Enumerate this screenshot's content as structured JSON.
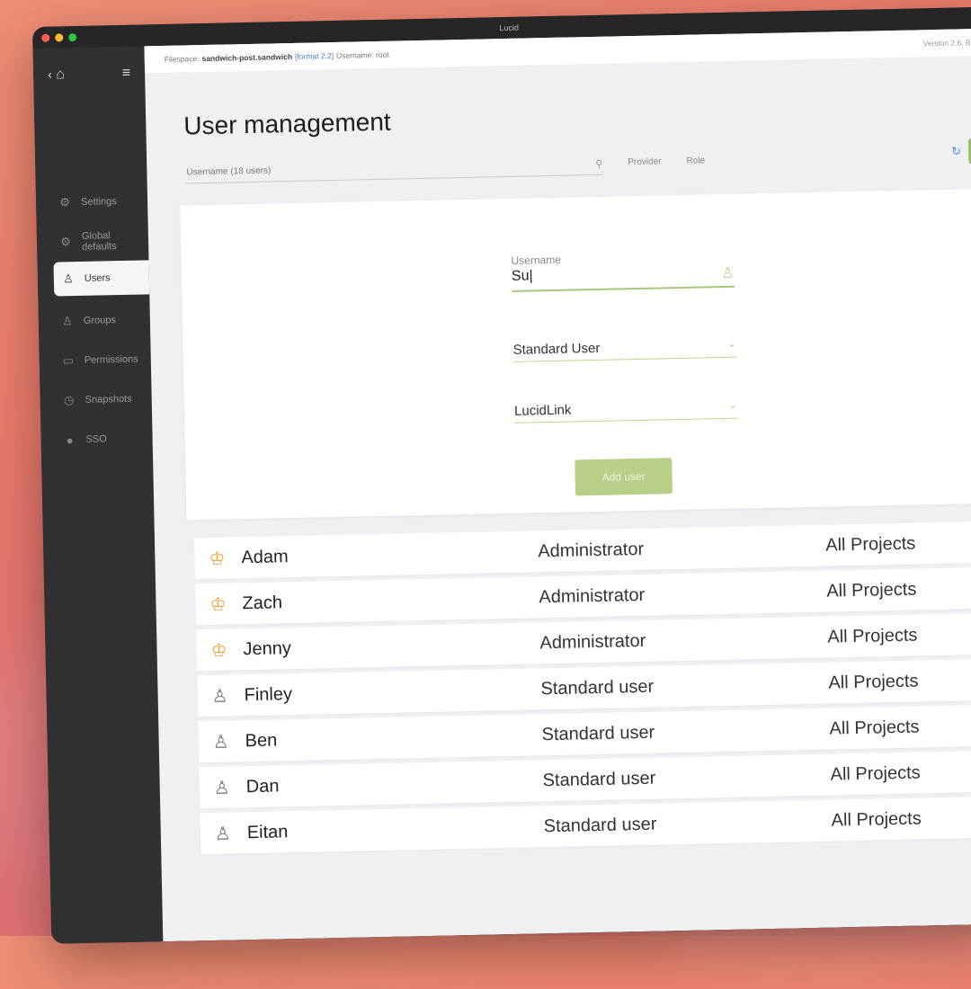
{
  "window": {
    "title": "Lucid"
  },
  "infobar": {
    "filespace_label": "Filespace:",
    "filespace_name": "sandwich-post.sandwich",
    "format": "[format 2.2]",
    "username": "Username: root",
    "version": "Version 2.6, B..."
  },
  "sidebar": {
    "items": [
      {
        "label": "Settings",
        "icon": "gear-icon"
      },
      {
        "label": "Global defaults",
        "icon": "globe-gear-icon"
      },
      {
        "label": "Users",
        "icon": "user-icon"
      },
      {
        "label": "Groups",
        "icon": "group-icon"
      },
      {
        "label": "Permissions",
        "icon": "folder-lock-icon"
      },
      {
        "label": "Snapshots",
        "icon": "clock-icon"
      },
      {
        "label": "SSO",
        "icon": "circle-icon"
      }
    ]
  },
  "page": {
    "title": "User management"
  },
  "filter": {
    "search_placeholder": "Username (18 users)",
    "col_provider": "Provider",
    "col_role": "Role"
  },
  "form": {
    "username_label": "Username",
    "username_value": "Su|",
    "role_value": "Standard User",
    "provider_value": "LucidLink",
    "add_button": "Add user"
  },
  "users": [
    {
      "name": "Adam",
      "role": "Administrator",
      "access": "All Projects",
      "type": "admin"
    },
    {
      "name": "Zach",
      "role": "Administrator",
      "access": "All Projects",
      "type": "admin"
    },
    {
      "name": "Jenny",
      "role": "Administrator",
      "access": "All Projects",
      "type": "admin"
    },
    {
      "name": "Finley",
      "role": "Standard user",
      "access": "All Projects",
      "type": "standard"
    },
    {
      "name": "Ben",
      "role": "Standard user",
      "access": "All Projects",
      "type": "standard"
    },
    {
      "name": "Dan",
      "role": "Standard user",
      "access": "All Projects",
      "type": "standard"
    },
    {
      "name": "Eitan",
      "role": "Standard user",
      "access": "All Projects",
      "type": "standard"
    }
  ],
  "colors": {
    "accent_green": "#9cc25a",
    "admin_star": "#f3a037",
    "sidebar_bg": "#313133"
  }
}
